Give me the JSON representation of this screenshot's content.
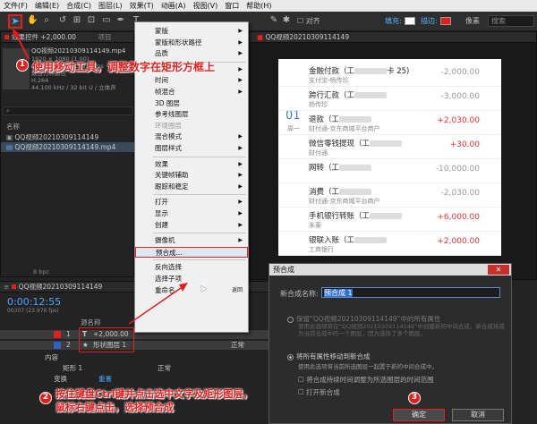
{
  "menubar": [
    "文件(F)",
    "编辑(E)",
    "合成(C)",
    "图层(L)",
    "效果(T)",
    "动画(A)",
    "视图(V)",
    "窗口",
    "帮助(H)"
  ],
  "toolbar": {
    "snap_label": "对齐",
    "fill_label": "填充:",
    "stroke_label": "描边:",
    "stroke_width": "像素",
    "search_placeholder": "搜索"
  },
  "effects_panel": {
    "tab": "效果控件 +2,000.00",
    "project_tab": "项目"
  },
  "project": {
    "file_name": "QQ视频20210309114149.mp4",
    "file_name2": "QQ视频20210309114149.mp4",
    "info_lines": [
      "1920 × 1080 (1.00)",
      "Δ 0;00;12;55, 23.976 fps",
      "数百万种颜色",
      "H.264",
      "44.100 kHz / 32 bit U / 立体声"
    ],
    "col_name": "名称",
    "items": [
      "QQ视频20210309114149",
      "QQ视频20210309114149.mp4"
    ],
    "bpc": "8 bpc"
  },
  "viewer_tab": "QQ视频20210309114149",
  "context_menu": [
    {
      "label": "蒙版",
      "arrow": true
    },
    {
      "label": "蒙版和形状路径",
      "arrow": true
    },
    {
      "label": "品质",
      "arrow": true
    },
    {
      "sep": true
    },
    {
      "label": "变换",
      "arrow": true
    },
    {
      "label": "时间",
      "arrow": true
    },
    {
      "label": "帧混合",
      "arrow": true
    },
    {
      "label": "3D 图层"
    },
    {
      "label": "参考线图层"
    },
    {
      "label": "环境图层",
      "disabled": true
    },
    {
      "label": "混合模式",
      "arrow": true
    },
    {
      "label": "图层样式",
      "arrow": true
    },
    {
      "sep": true
    },
    {
      "label": "效果",
      "arrow": true
    },
    {
      "label": "关键帧辅助",
      "arrow": true
    },
    {
      "label": "跟踪和稳定",
      "arrow": true
    },
    {
      "sep": true
    },
    {
      "label": "打开",
      "arrow": true
    },
    {
      "label": "显示",
      "arrow": true
    },
    {
      "label": "创建",
      "arrow": true
    },
    {
      "sep": true
    },
    {
      "label": "摄像机",
      "arrow": true
    },
    {
      "label": "预合成...",
      "highlight": true
    },
    {
      "sep": true
    },
    {
      "label": "反向选择"
    },
    {
      "label": "选择子项"
    },
    {
      "label": "重命名",
      "extra": "返回"
    }
  ],
  "annotations": {
    "step1": "使用移动工具，调整数字在矩形方框上",
    "step2_line1": "按住键盘Ctrl键并点击选中文字及矩形图层，",
    "step2_line2": "鼠标右键点击，选择预合成",
    "badge1": "1",
    "badge2": "2",
    "badge3": "3"
  },
  "bank": {
    "date_day": "01",
    "date_week": "周一",
    "rows": [
      {
        "title": "金融付款（工",
        "title2": "卡 25)",
        "sub": "支付宝-杨传珍",
        "amount": "-2,000.00",
        "positive": false
      },
      {
        "title": "跨行汇款（工",
        "title2": "",
        "sub": "杨传珍",
        "amount": "-3,000.00",
        "positive": false
      },
      {
        "title": "退款（工",
        "title2": "",
        "sub": "财付通-京东商城平台商户",
        "amount": "+2,030.00",
        "positive": true
      },
      {
        "title": "微信零钱提现（工",
        "title2": "",
        "sub": "财付通",
        "amount": "+30.00",
        "positive": true
      },
      {
        "title": "网转（工",
        "title2": "",
        "sub": "",
        "amount": "-10,000.00",
        "positive": false
      },
      {
        "title": "消费（工",
        "title2": "",
        "sub": "财付通-京东商城平台商户",
        "amount": "-2,030.00",
        "positive": false
      },
      {
        "title": "手机银行转账（工",
        "title2": "",
        "sub": "朱莱",
        "amount": "+6,000.00",
        "positive": true
      },
      {
        "title": "银联入账（工",
        "title2": "",
        "sub": "工商银行",
        "amount": "+2,000.00",
        "positive": true
      }
    ]
  },
  "dialog": {
    "title": "预合成",
    "close": "✕",
    "name_label": "新合成名称:",
    "name_value": "预合成 1",
    "option1": "保留“QQ视频20210309114149”中的所有属性",
    "option1_desc": "使用此选项将在“QQ视频20210309114149”中创建新的中间合成。新合成将成为当前合成中的一个图层，因为选择了多个图层。",
    "option2": "将所有属性移动到新合成",
    "option2_desc": "使用此选项将当前所选图层一起置于新的中间合成中。",
    "check1": "将合成持续时间调整为所选图层的时间范围",
    "check2": "打开新合成",
    "ok": "确定",
    "cancel": "取消"
  },
  "timeline": {
    "tab": "QQ视频20210309114149",
    "timecode": "0:00:12:55",
    "fps": "00307 (23.976 fps)",
    "col_source": "源名称",
    "layer1_num": "1",
    "layer1_name": "+2,000.00",
    "layer2_num": "2",
    "layer2_name": "形状图层 1",
    "mode_normal": "正常",
    "content": "内容",
    "rect": "矩形 1",
    "transform": "变换",
    "reset": "重置",
    "add": "添加: ●"
  }
}
